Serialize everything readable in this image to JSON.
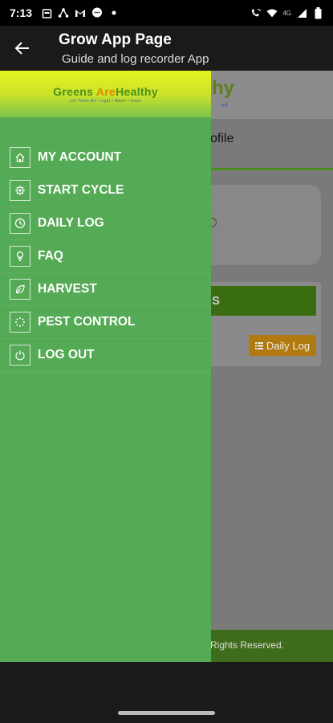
{
  "status_bar": {
    "time": "7:13",
    "network_label": "4G"
  },
  "app_bar": {
    "title": "Grow App Page",
    "subtitle": "Guide and log recorder App"
  },
  "background": {
    "logo_fragment": "hy",
    "logo_fragment_small": "ed",
    "tab_fragment": "ofile",
    "action_fragment": "S",
    "daily_log_label": "Daily Log",
    "footer_fragment": "Rights Reserved."
  },
  "drawer": {
    "logo_part1": "Greens ",
    "logo_part2": "Are",
    "logo_part3": "Healthy",
    "logo_tagline": "Let There Be • Light • Water • Food",
    "menu": [
      {
        "label": "MY ACCOUNT",
        "icon": "home-icon"
      },
      {
        "label": "START CYCLE",
        "icon": "gear-icon"
      },
      {
        "label": "DAILY LOG",
        "icon": "clock-icon"
      },
      {
        "label": "FAQ",
        "icon": "lightbulb-icon"
      },
      {
        "label": "HARVEST",
        "icon": "leaf-icon"
      },
      {
        "label": "PEST CONTROL",
        "icon": "spinner-icon"
      },
      {
        "label": "LOG OUT",
        "icon": "power-icon"
      }
    ]
  },
  "colors": {
    "drawer_bg": "#55aa55",
    "accent_green": "#4b8c1e",
    "daily_log_orange": "#b07a10"
  }
}
